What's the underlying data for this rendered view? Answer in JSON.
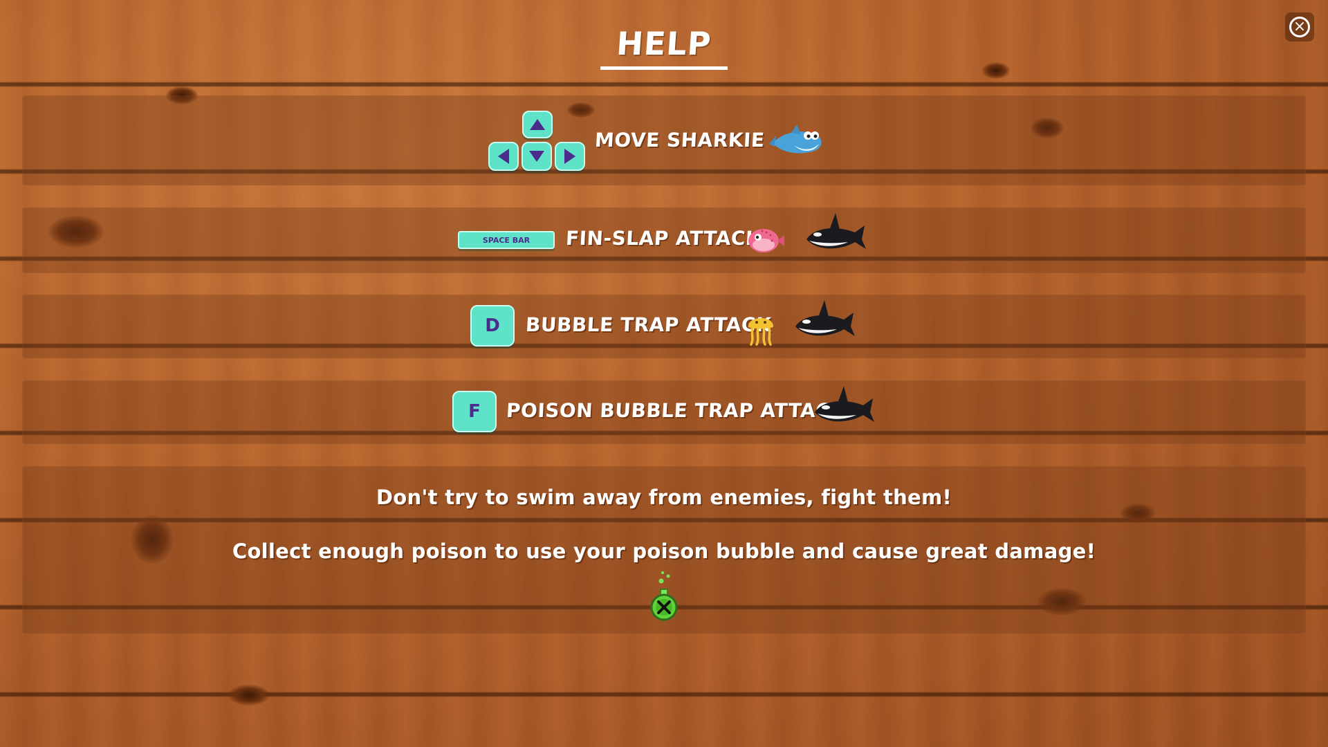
{
  "title": "HELP",
  "close_label": "×",
  "controls": [
    {
      "keys": [
        "▲",
        "◀",
        "▼",
        "▶"
      ],
      "action": "MOVE SHARKIE"
    },
    {
      "key": "SPACE BAR",
      "action": "FIN-SLAP ATTACK"
    },
    {
      "key": "D",
      "action": "BUBBLE TRAP ATTACK"
    },
    {
      "key": "F",
      "action": "POISON BUBBLE TRAP ATTACK"
    }
  ],
  "tips": [
    "Don't try to swim away from enemies, fight them!",
    "Collect enough poison to use your poison bubble and cause great damage!"
  ],
  "colors": {
    "key_fill": "#5fe3c8",
    "key_text": "#4b2b8c",
    "text": "#ffffff",
    "wood": "#b8642c"
  },
  "icons": [
    "shark-icon",
    "pufferfish-icon",
    "orca-icon",
    "jellyfish-icon",
    "poison-bottle-icon",
    "close-icon"
  ]
}
